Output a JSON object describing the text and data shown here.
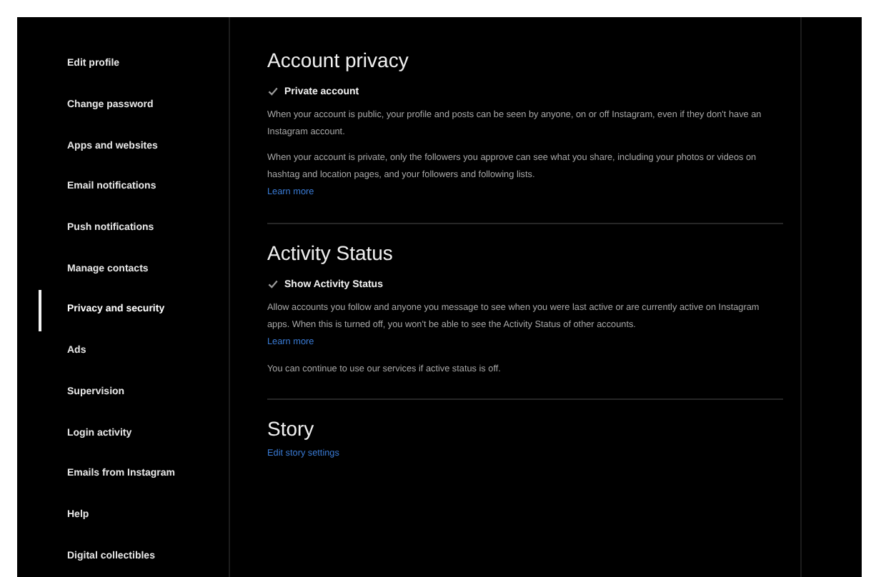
{
  "sidebar": {
    "items": [
      {
        "label": "Edit profile",
        "selected": false
      },
      {
        "label": "Change password",
        "selected": false
      },
      {
        "label": "Apps and websites",
        "selected": false
      },
      {
        "label": "Email notifications",
        "selected": false
      },
      {
        "label": "Push notifications",
        "selected": false
      },
      {
        "label": "Manage contacts",
        "selected": false
      },
      {
        "label": "Privacy and security",
        "selected": true
      },
      {
        "label": "Ads",
        "selected": false
      },
      {
        "label": "Supervision",
        "selected": false
      },
      {
        "label": "Login activity",
        "selected": false
      },
      {
        "label": "Emails from Instagram",
        "selected": false
      },
      {
        "label": "Help",
        "selected": false
      },
      {
        "label": "Digital collectibles",
        "selected": false
      }
    ]
  },
  "sections": [
    {
      "title": "Account privacy",
      "blocks": [
        {
          "kind": "checkbox",
          "label": "Private account",
          "checked": true
        },
        {
          "kind": "text",
          "text": "When your account is public, your profile and posts can be seen by anyone, on or off Instagram, even if they don't have an Instagram account."
        },
        {
          "kind": "text",
          "text": "When your account is private, only the followers you approve can see what you share, including your photos or videos on hashtag and location pages, and your followers and following lists."
        },
        {
          "kind": "link",
          "text": "Learn more"
        }
      ]
    },
    {
      "title": "Activity Status",
      "blocks": [
        {
          "kind": "checkbox",
          "label": "Show Activity Status",
          "checked": true
        },
        {
          "kind": "text",
          "text": "Allow accounts you follow and anyone you message to see when you were last active or are currently active on Instagram apps. When this is turned off, you won't be able to see the Activity Status of other accounts."
        },
        {
          "kind": "link",
          "text": "Learn more"
        },
        {
          "kind": "text",
          "text": "You can continue to use our services if active status is off."
        }
      ]
    },
    {
      "title": "Story",
      "blocks": [
        {
          "kind": "link",
          "text": "Edit story settings"
        }
      ]
    }
  ]
}
